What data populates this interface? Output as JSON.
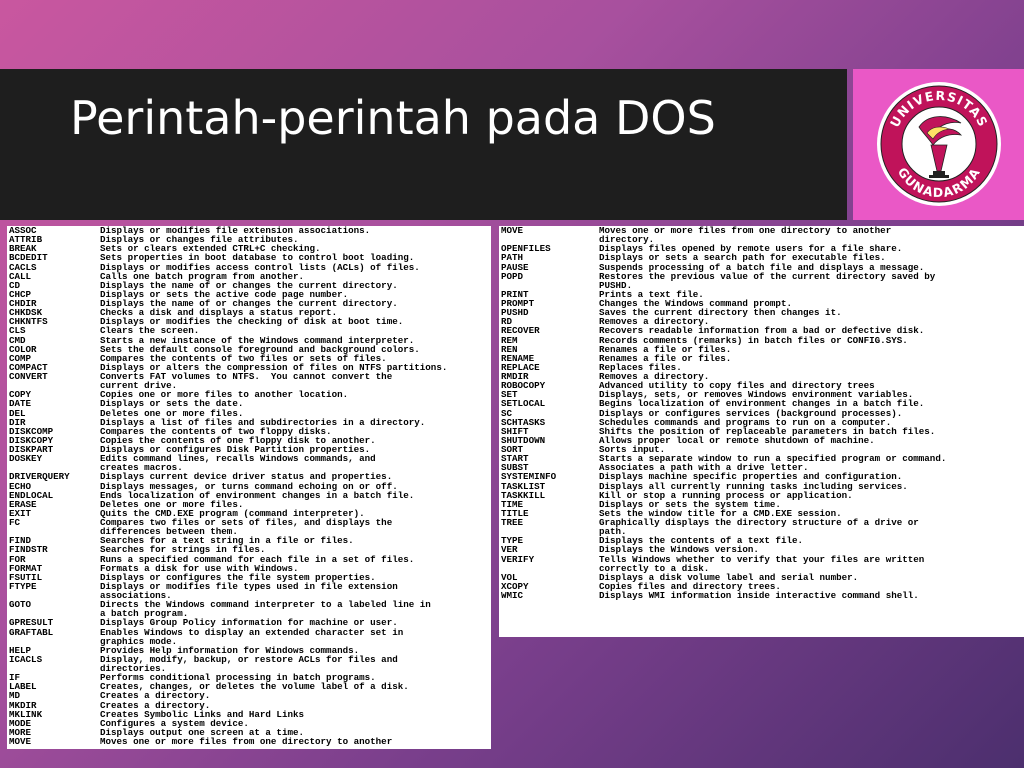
{
  "slide": {
    "title": "Perintah-perintah pada DOS",
    "logo": {
      "icon": "universitas-gunadarma-logo",
      "text_top": "UNIVERSITAS",
      "text_bottom": "GUNADARMA",
      "colors": {
        "ring": "#c0135a",
        "flame": "#ffffff",
        "bg": "#ea58c6"
      }
    }
  },
  "left_table": [
    {
      "cmd": "ASSOC",
      "desc": "Displays or modifies file extension associations."
    },
    {
      "cmd": "ATTRIB",
      "desc": "Displays or changes file attributes."
    },
    {
      "cmd": "BREAK",
      "desc": "Sets or clears extended CTRL+C checking."
    },
    {
      "cmd": "BCDEDIT",
      "desc": "Sets properties in boot database to control boot loading."
    },
    {
      "cmd": "CACLS",
      "desc": "Displays or modifies access control lists (ACLs) of files."
    },
    {
      "cmd": "CALL",
      "desc": "Calls one batch program from another."
    },
    {
      "cmd": "CD",
      "desc": "Displays the name of or changes the current directory."
    },
    {
      "cmd": "CHCP",
      "desc": "Displays or sets the active code page number."
    },
    {
      "cmd": "CHDIR",
      "desc": "Displays the name of or changes the current directory."
    },
    {
      "cmd": "CHKDSK",
      "desc": "Checks a disk and displays a status report."
    },
    {
      "cmd": "CHKNTFS",
      "desc": "Displays or modifies the checking of disk at boot time."
    },
    {
      "cmd": "CLS",
      "desc": "Clears the screen."
    },
    {
      "cmd": "CMD",
      "desc": "Starts a new instance of the Windows command interpreter."
    },
    {
      "cmd": "COLOR",
      "desc": "Sets the default console foreground and background colors."
    },
    {
      "cmd": "COMP",
      "desc": "Compares the contents of two files or sets of files."
    },
    {
      "cmd": "COMPACT",
      "desc": "Displays or alters the compression of files on NTFS partitions."
    },
    {
      "cmd": "CONVERT",
      "desc": "Converts FAT volumes to NTFS.  You cannot convert the"
    },
    {
      "cmd": "",
      "desc": "current drive."
    },
    {
      "cmd": "COPY",
      "desc": "Copies one or more files to another location."
    },
    {
      "cmd": "DATE",
      "desc": "Displays or sets the date."
    },
    {
      "cmd": "DEL",
      "desc": "Deletes one or more files."
    },
    {
      "cmd": "DIR",
      "desc": "Displays a list of files and subdirectories in a directory."
    },
    {
      "cmd": "DISKCOMP",
      "desc": "Compares the contents of two floppy disks."
    },
    {
      "cmd": "DISKCOPY",
      "desc": "Copies the contents of one floppy disk to another."
    },
    {
      "cmd": "DISKPART",
      "desc": "Displays or configures Disk Partition properties."
    },
    {
      "cmd": "DOSKEY",
      "desc": "Edits command lines, recalls Windows commands, and"
    },
    {
      "cmd": "",
      "desc": "creates macros."
    },
    {
      "cmd": "DRIVERQUERY",
      "desc": "Displays current device driver status and properties."
    },
    {
      "cmd": "ECHO",
      "desc": "Displays messages, or turns command echoing on or off."
    },
    {
      "cmd": "ENDLOCAL",
      "desc": "Ends localization of environment changes in a batch file."
    },
    {
      "cmd": "ERASE",
      "desc": "Deletes one or more files."
    },
    {
      "cmd": "EXIT",
      "desc": "Quits the CMD.EXE program (command interpreter)."
    },
    {
      "cmd": "FC",
      "desc": "Compares two files or sets of files, and displays the"
    },
    {
      "cmd": "",
      "desc": "differences between them."
    },
    {
      "cmd": "FIND",
      "desc": "Searches for a text string in a file or files."
    },
    {
      "cmd": "FINDSTR",
      "desc": "Searches for strings in files."
    },
    {
      "cmd": "FOR",
      "desc": "Runs a specified command for each file in a set of files."
    },
    {
      "cmd": "FORMAT",
      "desc": "Formats a disk for use with Windows."
    },
    {
      "cmd": "FSUTIL",
      "desc": "Displays or configures the file system properties."
    },
    {
      "cmd": "FTYPE",
      "desc": "Displays or modifies file types used in file extension"
    },
    {
      "cmd": "",
      "desc": "associations."
    },
    {
      "cmd": "GOTO",
      "desc": "Directs the Windows command interpreter to a labeled line in"
    },
    {
      "cmd": "",
      "desc": "a batch program."
    },
    {
      "cmd": "GPRESULT",
      "desc": "Displays Group Policy information for machine or user."
    },
    {
      "cmd": "GRAFTABL",
      "desc": "Enables Windows to display an extended character set in"
    },
    {
      "cmd": "",
      "desc": "graphics mode."
    },
    {
      "cmd": "HELP",
      "desc": "Provides Help information for Windows commands."
    },
    {
      "cmd": "ICACLS",
      "desc": "Display, modify, backup, or restore ACLs for files and"
    },
    {
      "cmd": "",
      "desc": "directories."
    },
    {
      "cmd": "IF",
      "desc": "Performs conditional processing in batch programs."
    },
    {
      "cmd": "LABEL",
      "desc": "Creates, changes, or deletes the volume label of a disk."
    },
    {
      "cmd": "MD",
      "desc": "Creates a directory."
    },
    {
      "cmd": "MKDIR",
      "desc": "Creates a directory."
    },
    {
      "cmd": "MKLINK",
      "desc": "Creates Symbolic Links and Hard Links"
    },
    {
      "cmd": "MODE",
      "desc": "Configures a system device."
    },
    {
      "cmd": "MORE",
      "desc": "Displays output one screen at a time."
    },
    {
      "cmd": "MOVE",
      "desc": "Moves one or more files from one directory to another"
    }
  ],
  "right_table": [
    {
      "cmd": "MOVE",
      "desc": "Moves one or more files from one directory to another"
    },
    {
      "cmd": "",
      "desc": "directory."
    },
    {
      "cmd": "OPENFILES",
      "desc": "Displays files opened by remote users for a file share."
    },
    {
      "cmd": "PATH",
      "desc": "Displays or sets a search path for executable files."
    },
    {
      "cmd": "PAUSE",
      "desc": "Suspends processing of a batch file and displays a message."
    },
    {
      "cmd": "POPD",
      "desc": "Restores the previous value of the current directory saved by"
    },
    {
      "cmd": "",
      "desc": "PUSHD."
    },
    {
      "cmd": "PRINT",
      "desc": "Prints a text file."
    },
    {
      "cmd": "PROMPT",
      "desc": "Changes the Windows command prompt."
    },
    {
      "cmd": "PUSHD",
      "desc": "Saves the current directory then changes it."
    },
    {
      "cmd": "RD",
      "desc": "Removes a directory."
    },
    {
      "cmd": "RECOVER",
      "desc": "Recovers readable information from a bad or defective disk."
    },
    {
      "cmd": "REM",
      "desc": "Records comments (remarks) in batch files or CONFIG.SYS."
    },
    {
      "cmd": "REN",
      "desc": "Renames a file or files."
    },
    {
      "cmd": "RENAME",
      "desc": "Renames a file or files."
    },
    {
      "cmd": "REPLACE",
      "desc": "Replaces files."
    },
    {
      "cmd": "RMDIR",
      "desc": "Removes a directory."
    },
    {
      "cmd": "ROBOCOPY",
      "desc": "Advanced utility to copy files and directory trees"
    },
    {
      "cmd": "SET",
      "desc": "Displays, sets, or removes Windows environment variables."
    },
    {
      "cmd": "SETLOCAL",
      "desc": "Begins localization of environment changes in a batch file."
    },
    {
      "cmd": "SC",
      "desc": "Displays or configures services (background processes)."
    },
    {
      "cmd": "SCHTASKS",
      "desc": "Schedules commands and programs to run on a computer."
    },
    {
      "cmd": "SHIFT",
      "desc": "Shifts the position of replaceable parameters in batch files."
    },
    {
      "cmd": "SHUTDOWN",
      "desc": "Allows proper local or remote shutdown of machine."
    },
    {
      "cmd": "SORT",
      "desc": "Sorts input."
    },
    {
      "cmd": "START",
      "desc": "Starts a separate window to run a specified program or command."
    },
    {
      "cmd": "SUBST",
      "desc": "Associates a path with a drive letter."
    },
    {
      "cmd": "SYSTEMINFO",
      "desc": "Displays machine specific properties and configuration."
    },
    {
      "cmd": "TASKLIST",
      "desc": "Displays all currently running tasks including services."
    },
    {
      "cmd": "TASKKILL",
      "desc": "Kill or stop a running process or application."
    },
    {
      "cmd": "TIME",
      "desc": "Displays or sets the system time."
    },
    {
      "cmd": "TITLE",
      "desc": "Sets the window title for a CMD.EXE session."
    },
    {
      "cmd": "TREE",
      "desc": "Graphically displays the directory structure of a drive or"
    },
    {
      "cmd": "",
      "desc": "path."
    },
    {
      "cmd": "TYPE",
      "desc": "Displays the contents of a text file."
    },
    {
      "cmd": "VER",
      "desc": "Displays the Windows version."
    },
    {
      "cmd": "VERIFY",
      "desc": "Tells Windows whether to verify that your files are written"
    },
    {
      "cmd": "",
      "desc": "correctly to a disk."
    },
    {
      "cmd": "VOL",
      "desc": "Displays a disk volume label and serial number."
    },
    {
      "cmd": "XCOPY",
      "desc": "Copies files and directory trees."
    },
    {
      "cmd": "WMIC",
      "desc": "Displays WMI information inside interactive command shell."
    }
  ]
}
